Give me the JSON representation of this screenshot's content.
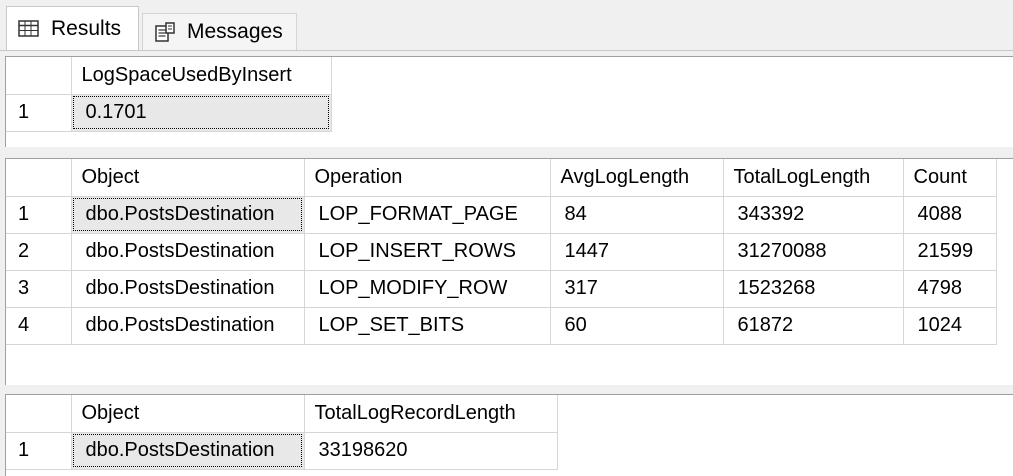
{
  "tabs": [
    {
      "label": "Results",
      "icon": "grid-icon",
      "active": true
    },
    {
      "label": "Messages",
      "icon": "messages-icon",
      "active": false
    }
  ],
  "result1": {
    "columns": [
      "",
      "LogSpaceUsedByInsert"
    ],
    "rows": [
      [
        "1",
        "0.1701"
      ]
    ]
  },
  "result2": {
    "columns": [
      "",
      "Object",
      "Operation",
      "AvgLogLength",
      "TotalLogLength",
      "Count"
    ],
    "rows": [
      [
        "1",
        "dbo.PostsDestination",
        "LOP_FORMAT_PAGE",
        "84",
        "343392",
        "4088"
      ],
      [
        "2",
        "dbo.PostsDestination",
        "LOP_INSERT_ROWS",
        "1447",
        "31270088",
        "21599"
      ],
      [
        "3",
        "dbo.PostsDestination",
        "LOP_MODIFY_ROW",
        "317",
        "1523268",
        "4798"
      ],
      [
        "4",
        "dbo.PostsDestination",
        "LOP_SET_BITS",
        "60",
        "61872",
        "1024"
      ]
    ]
  },
  "result3": {
    "columns": [
      "",
      "Object",
      "TotalLogRecordLength"
    ],
    "rows": [
      [
        "1",
        "dbo.PostsDestination",
        "33198620"
      ]
    ]
  },
  "colors": {
    "selection": "#e8e8e8",
    "gridline": "#d6d6d6",
    "background": "#f0f0f0"
  }
}
